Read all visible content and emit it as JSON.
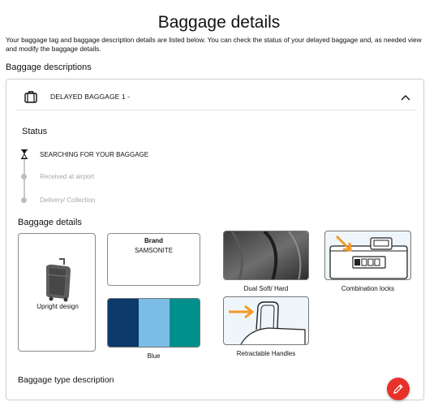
{
  "page": {
    "title": "Baggage details",
    "intro": "Your baggage tag and baggage description details are listed below. You can check the status of your delayed baggage and, as needed view and modify the baggage details.",
    "section_heading": "Baggage descriptions"
  },
  "bag_card": {
    "title": "DELAYED BAGGAGE 1 -",
    "icons": {
      "bag": "suitcase-icon",
      "toggle": "chevron-up-icon"
    }
  },
  "status": {
    "title": "Status",
    "steps": [
      {
        "label": "SEARCHING FOR YOUR BAGGAGE",
        "state": "active",
        "icon": "hourglass-icon"
      },
      {
        "label": "Received at airport",
        "state": "inactive"
      },
      {
        "label": "Delivery/ Collection",
        "state": "inactive"
      }
    ]
  },
  "baggage_details": {
    "title": "Baggage details",
    "design": {
      "caption": "Upright design"
    },
    "brand": {
      "label": "Brand",
      "value": "SAMSONITE"
    },
    "material": {
      "caption": "Dual Soft/ Hard"
    },
    "locks": {
      "caption": "Combination locks"
    },
    "color": {
      "caption": "Blue",
      "swatches": [
        "#0b3a6b",
        "#7bbde6",
        "#008f8c"
      ]
    },
    "handles": {
      "caption": "Retractable Handles"
    }
  },
  "type_description": {
    "title": "Baggage type description"
  },
  "edit_button": {
    "icon": "pencil-icon",
    "color": "#e8312a"
  },
  "colors": {
    "accent_arrow": "#f39a26"
  }
}
